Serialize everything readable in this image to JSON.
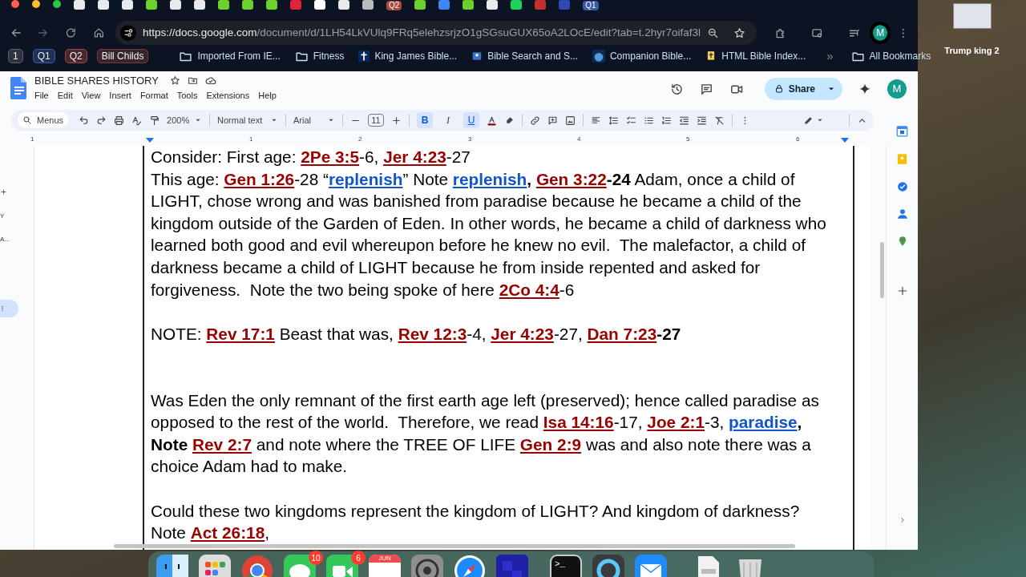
{
  "browser": {
    "tab_labels": [
      "Q2",
      "Q1"
    ],
    "url": {
      "host": "https://docs.google.com",
      "path": "/document/d/1LH54LkVUlq9FRq5elehzsrjzO1gSGsuGUX65oA2LOcE/edit?tab=t.2hyr7oifaf3l"
    },
    "profile_initial": "M",
    "bookmarks": [
      {
        "kind": "badge",
        "label": "1",
        "color": "#5f6368"
      },
      {
        "kind": "badge",
        "label": "Q1",
        "color": "#3b5ba5"
      },
      {
        "kind": "badge",
        "label": "Q2",
        "color": "#a8463f"
      },
      {
        "kind": "badge",
        "label": "Bill Childs",
        "color": "#7a3b38"
      },
      {
        "kind": "apps"
      },
      {
        "kind": "folder",
        "label": "Imported From IE..."
      },
      {
        "kind": "folder",
        "label": "Fitness"
      },
      {
        "kind": "cross",
        "label": "King James Bible..."
      },
      {
        "kind": "book",
        "label": "Bible Search and S..."
      },
      {
        "kind": "globe",
        "label": "Companion Bible..."
      },
      {
        "kind": "bible",
        "label": "HTML Bible Index..."
      },
      {
        "kind": "more",
        "label": "»"
      },
      {
        "kind": "folder",
        "label": "All Bookmarks"
      }
    ]
  },
  "docs": {
    "title": "BIBLE SHARES HISTORY",
    "menu": [
      "File",
      "Edit",
      "View",
      "Insert",
      "Format",
      "Tools",
      "Extensions",
      "Help"
    ],
    "share": "Share",
    "account_initial": "M",
    "toolbar": {
      "search": "Menus",
      "zoom": "200%",
      "style": "Normal text",
      "font": "Arial",
      "size": "11",
      "formats": [
        {
          "label": "B",
          "selected": true
        },
        {
          "label": "I",
          "selected": false
        },
        {
          "label": "U",
          "selected": true
        }
      ]
    },
    "ruler": [
      "1",
      "1",
      "2",
      "3",
      "4",
      "5",
      "6"
    ],
    "outline": [
      "Y",
      "A..."
    ],
    "paragraphs": [
      {
        "kind": "line",
        "runs": [
          {
            "text": "Consider: First age: ",
            "kind": "plain"
          },
          {
            "text": "2Pe 3:5",
            "kind": "ref"
          },
          {
            "text": "-6, ",
            "kind": "plain"
          },
          {
            "text": "Jer 4:23",
            "kind": "ref"
          },
          {
            "text": "-27",
            "kind": "plain"
          }
        ]
      },
      {
        "kind": "line",
        "runs": [
          {
            "text": "This age: ",
            "kind": "plain"
          },
          {
            "text": "Gen 1:26",
            "kind": "ref"
          },
          {
            "text": "-28 “",
            "kind": "plain"
          },
          {
            "text": "replenish",
            "kind": "link"
          },
          {
            "text": "” Note ",
            "kind": "plain"
          },
          {
            "text": "replenish",
            "kind": "link"
          },
          {
            "text": ", ",
            "kind": "bold"
          },
          {
            "text": "Gen 3:22",
            "kind": "ref"
          },
          {
            "text": "-24",
            "kind": "bold"
          },
          {
            "text": " Adam, once a child of LIGHT, chose wrong and was banished from paradise because he became a child of the kingdom outside of the Garden of Eden. In other words, he became a child of darkness who learned both good and evil whereupon before he knew no evil.  The malefactor, a child of darkness became a child of LIGHT because he from inside repented and asked for forgiveness.  Note the two being spoke of here ",
            "kind": "plain"
          },
          {
            "text": "2Co 4:4",
            "kind": "ref"
          },
          {
            "text": "-6",
            "kind": "plain"
          }
        ]
      },
      {
        "kind": "after_gap",
        "runs": [
          {
            "text": "NOTE: ",
            "kind": "plain"
          },
          {
            "text": "Rev 17:1",
            "kind": "ref"
          },
          {
            "text": " Beast that was, ",
            "kind": "plain"
          },
          {
            "text": "Rev 12:3",
            "kind": "ref"
          },
          {
            "text": "-4, ",
            "kind": "plain"
          },
          {
            "text": "Jer 4:23",
            "kind": "ref"
          },
          {
            "text": "-27, ",
            "kind": "plain"
          },
          {
            "text": "Dan 7:23",
            "kind": "ref"
          },
          {
            "text": "-27",
            "kind": "bold"
          }
        ]
      },
      {
        "kind": "after_double_gap",
        "runs": [
          {
            "text": "Was Eden the only remnant of the first earth age left (preserved); hence called paradise as opposed to the rest of the world.  Therefore, we read ",
            "kind": "plain"
          },
          {
            "text": "Isa 14:16",
            "kind": "ref"
          },
          {
            "text": "-17, ",
            "kind": "plain"
          },
          {
            "text": "Joe 2:1",
            "kind": "ref"
          },
          {
            "text": "-3, ",
            "kind": "plain"
          },
          {
            "text": "paradise",
            "kind": "link"
          },
          {
            "text": ", Note ",
            "kind": "bold"
          },
          {
            "text": "Rev 2:7",
            "kind": "ref"
          },
          {
            "text": " and note where the TREE OF LIFE ",
            "kind": "plain"
          },
          {
            "text": "Gen 2:9",
            "kind": "ref"
          },
          {
            "text": " was and also note there was a choice Adam had to make.",
            "kind": "plain"
          }
        ]
      },
      {
        "kind": "after_gap",
        "runs": [
          {
            "text": "Could these two kingdoms represent the kingdom of LIGHT? And kingdom of darkness?",
            "kind": "plain"
          }
        ]
      },
      {
        "kind": "line",
        "runs": [
          {
            "text": "Note ",
            "kind": "plain"
          },
          {
            "text": "Act 26:18",
            "kind": "ref"
          },
          {
            "text": ",",
            "kind": "plain"
          }
        ]
      }
    ]
  },
  "desktop": {
    "thumbnail_caption": "Trump king 2"
  },
  "dock": [
    {
      "kind": "finder"
    },
    {
      "kind": "launchpad"
    },
    {
      "kind": "chrome"
    },
    {
      "kind": "messages",
      "badge": "10"
    },
    {
      "kind": "facetime",
      "badge": "6"
    },
    {
      "kind": "calendar",
      "month": "JUN"
    },
    {
      "kind": "settings"
    },
    {
      "kind": "safari"
    },
    {
      "kind": "app"
    },
    {
      "kind": "terminal",
      "prompt": ">_"
    },
    {
      "kind": "quicktime"
    },
    {
      "kind": "mail"
    },
    {
      "kind": "document"
    },
    {
      "kind": "trash"
    }
  ]
}
